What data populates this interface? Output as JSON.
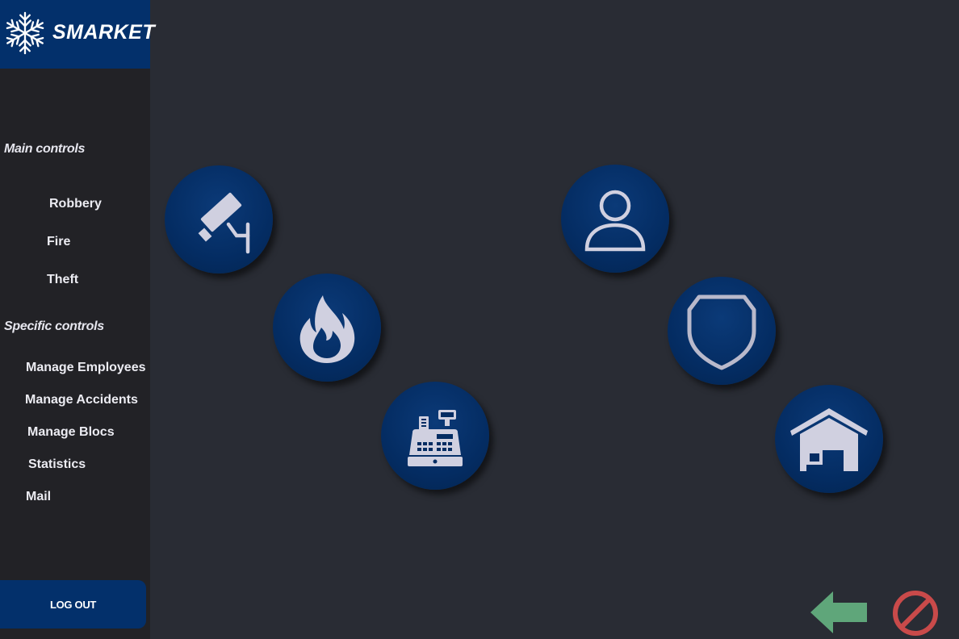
{
  "brand": {
    "name": "SMARKET",
    "icon": "snowflake-icon"
  },
  "sidebar": {
    "main_title": "Main controls",
    "main_items": [
      {
        "label": "Robbery"
      },
      {
        "label": "Fire"
      },
      {
        "label": "Theft"
      }
    ],
    "specific_title": "Specific controls",
    "specific_items": [
      {
        "label": "Manage Employees"
      },
      {
        "label": "Manage Accidents"
      },
      {
        "label": "Manage Blocs"
      },
      {
        "label": "Statistics"
      },
      {
        "label": "Mail"
      }
    ],
    "logout_label": "LOG OUT"
  },
  "controls": [
    {
      "icon": "security-camera-icon"
    },
    {
      "icon": "fire-icon"
    },
    {
      "icon": "cash-register-icon"
    },
    {
      "icon": "user-icon"
    },
    {
      "icon": "shield-icon"
    },
    {
      "icon": "warehouse-icon"
    }
  ],
  "footer": {
    "back_icon": "back-arrow-icon",
    "cancel_icon": "cancel-icon"
  },
  "colors": {
    "brand": "#03306b",
    "background": "#292c34",
    "sidebar": "#222226",
    "icon_fill": "#d0d0e0",
    "back_arrow": "#5fa67a",
    "cancel": "#c94a4a"
  }
}
